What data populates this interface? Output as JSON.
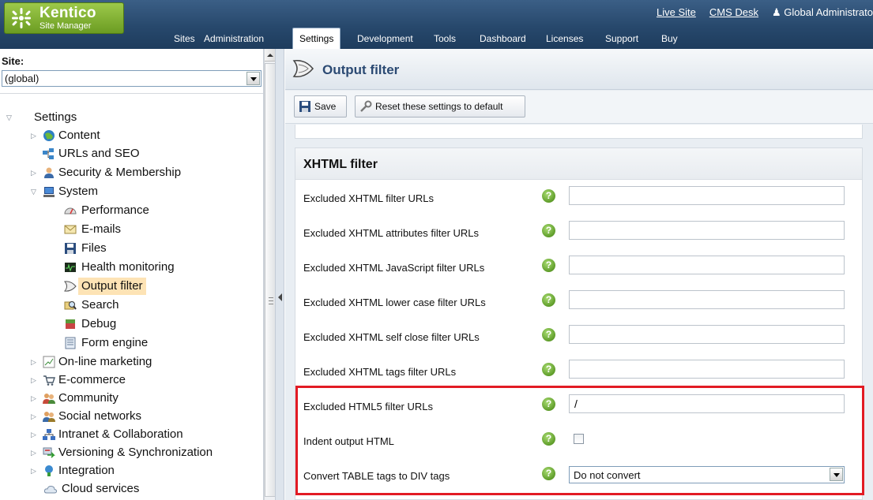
{
  "brand": {
    "name": "Kentico",
    "subtitle": "Site Manager"
  },
  "top_links": {
    "live_site": "Live Site",
    "cms_desk": "CMS Desk",
    "user": "Global Administrato"
  },
  "main_tabs": [
    "Sites",
    "Administration",
    "Settings",
    "Development",
    "Tools",
    "Dashboard",
    "Licenses",
    "Support",
    "Buy"
  ],
  "active_tab": "Settings",
  "site": {
    "label": "Site:",
    "value": "(global)"
  },
  "tree": [
    {
      "label": "Settings",
      "icon": "none",
      "expanded": true
    },
    {
      "label": "Content",
      "icon": "globe-icon"
    },
    {
      "label": "URLs and SEO",
      "icon": "sitemap-icon"
    },
    {
      "label": "Security & Membership",
      "icon": "user-icon"
    },
    {
      "label": "System",
      "icon": "computer-icon",
      "expanded": true
    },
    {
      "label": "Performance",
      "icon": "gauge-icon"
    },
    {
      "label": "E-mails",
      "icon": "envelope-icon"
    },
    {
      "label": "Files",
      "icon": "floppy-icon"
    },
    {
      "label": "Health monitoring",
      "icon": "monitor-icon"
    },
    {
      "label": "Output filter",
      "icon": "filter-icon",
      "selected": true
    },
    {
      "label": "Search",
      "icon": "search-icon"
    },
    {
      "label": "Debug",
      "icon": "debug-icon"
    },
    {
      "label": "Form engine",
      "icon": "form-icon"
    },
    {
      "label": "On-line marketing",
      "icon": "chart-icon"
    },
    {
      "label": "E-commerce",
      "icon": "cart-icon"
    },
    {
      "label": "Community",
      "icon": "people-icon"
    },
    {
      "label": "Social networks",
      "icon": "people-icon"
    },
    {
      "label": "Intranet & Collaboration",
      "icon": "network-icon"
    },
    {
      "label": "Versioning & Synchronization",
      "icon": "sync-icon"
    },
    {
      "label": "Integration",
      "icon": "integration-icon"
    },
    {
      "label": "Cloud services",
      "icon": "cloud-icon"
    }
  ],
  "page": {
    "title": "Output filter"
  },
  "toolbar": {
    "save_label": "Save",
    "reset_label": "Reset these settings to default"
  },
  "section": {
    "title": "XHTML filter"
  },
  "settings": [
    {
      "label": "Excluded XHTML filter URLs",
      "type": "text",
      "value": ""
    },
    {
      "label": "Excluded XHTML attributes filter URLs",
      "type": "text",
      "value": ""
    },
    {
      "label": "Excluded XHTML JavaScript filter URLs",
      "type": "text",
      "value": ""
    },
    {
      "label": "Excluded XHTML lower case filter URLs",
      "type": "text",
      "value": ""
    },
    {
      "label": "Excluded XHTML self close filter URLs",
      "type": "text",
      "value": ""
    },
    {
      "label": "Excluded XHTML tags filter URLs",
      "type": "text",
      "value": ""
    },
    {
      "label": "Excluded HTML5 filter URLs",
      "type": "text",
      "value": "/"
    },
    {
      "label": "Indent output HTML",
      "type": "checkbox",
      "checked": false
    },
    {
      "label": "Convert TABLE tags to DIV tags",
      "type": "select",
      "value": "Do not convert"
    }
  ],
  "help_symbol": "?",
  "colors": {
    "header": "#27486c",
    "brand_green": "#7fb034",
    "highlight": "#e21b24",
    "title_blue": "#2b4a73"
  }
}
